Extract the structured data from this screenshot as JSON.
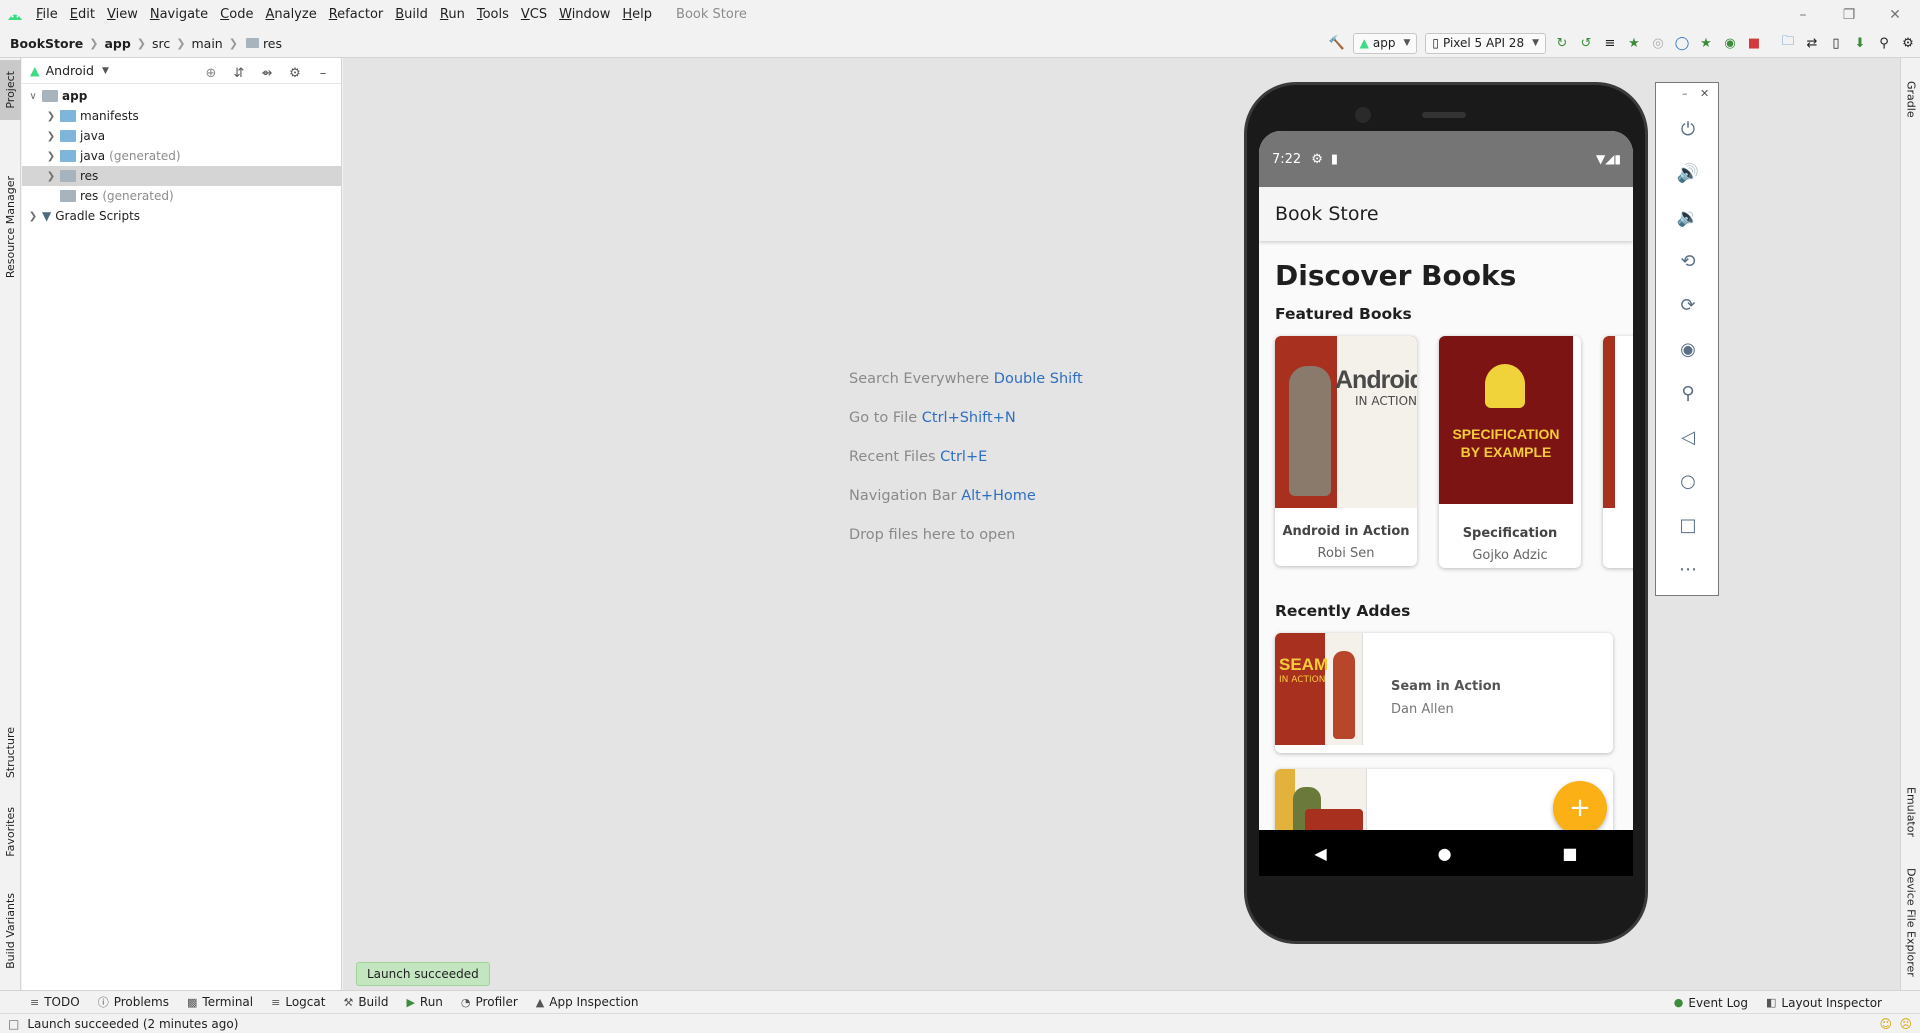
{
  "menu": [
    "File",
    "Edit",
    "View",
    "Navigate",
    "Code",
    "Analyze",
    "Refactor",
    "Build",
    "Run",
    "Tools",
    "VCS",
    "Window",
    "Help"
  ],
  "project_title": "Book Store",
  "breadcrumbs": [
    "BookStore",
    "app",
    "src",
    "main",
    "res"
  ],
  "toolbar": {
    "module_combo": "app",
    "device_combo": "Pixel 5 API 28"
  },
  "left_tabs": {
    "project": "Project",
    "resource_manager": "Resource Manager",
    "structure": "Structure",
    "favorites": "Favorites",
    "build_variants": "Build Variants"
  },
  "right_tabs": {
    "gradle": "Gradle",
    "emulator": "Emulator",
    "device_file_explorer": "Device File Explorer"
  },
  "panel": {
    "view_selector": "Android"
  },
  "tree": [
    {
      "label": "app",
      "note": ""
    },
    {
      "label": "manifests",
      "note": ""
    },
    {
      "label": "java",
      "note": ""
    },
    {
      "label": "java",
      "note": "(generated)"
    },
    {
      "label": "res",
      "note": ""
    },
    {
      "label": "res",
      "note": "(generated)"
    },
    {
      "label": "Gradle Scripts",
      "note": ""
    }
  ],
  "hints": [
    {
      "text": "Search Everywhere",
      "key": "Double Shift"
    },
    {
      "text": "Go to File",
      "key": "Ctrl+Shift+N"
    },
    {
      "text": "Recent Files",
      "key": "Ctrl+E"
    },
    {
      "text": "Navigation Bar",
      "key": "Alt+Home"
    },
    {
      "text": "Drop files here to open",
      "key": ""
    }
  ],
  "bottom_tools": [
    "TODO",
    "Problems",
    "Terminal",
    "Logcat",
    "Build",
    "Run",
    "Profiler",
    "App Inspection"
  ],
  "bottom_right": [
    "Event Log",
    "Layout Inspector"
  ],
  "toast": "Launch succeeded",
  "status": "Launch succeeded (2 minutes ago)",
  "phone": {
    "time": "7:22",
    "app_title": "Book Store",
    "heading": "Discover Books",
    "featured_title": "Featured Books",
    "featured": [
      {
        "title": "Android in Action",
        "author": "Robi Sen",
        "cover_title": "Android",
        "cover_sub": "IN ACTION"
      },
      {
        "title": "Specification",
        "author": "Gojko Adzic",
        "cover_title": "SPECIFICATION",
        "cover_sub": "BY EXAMPLE"
      }
    ],
    "recent_title": "Recently Addes",
    "recent": [
      {
        "title": "Seam in Action",
        "author": "Dan Allen",
        "cover_title": "SEAM",
        "cover_sub": "IN ACTION"
      }
    ],
    "fab": "+"
  },
  "colors": {
    "accent": "#2f6fbf",
    "fab": "#fbb116",
    "cover_red": "#a8301f"
  }
}
